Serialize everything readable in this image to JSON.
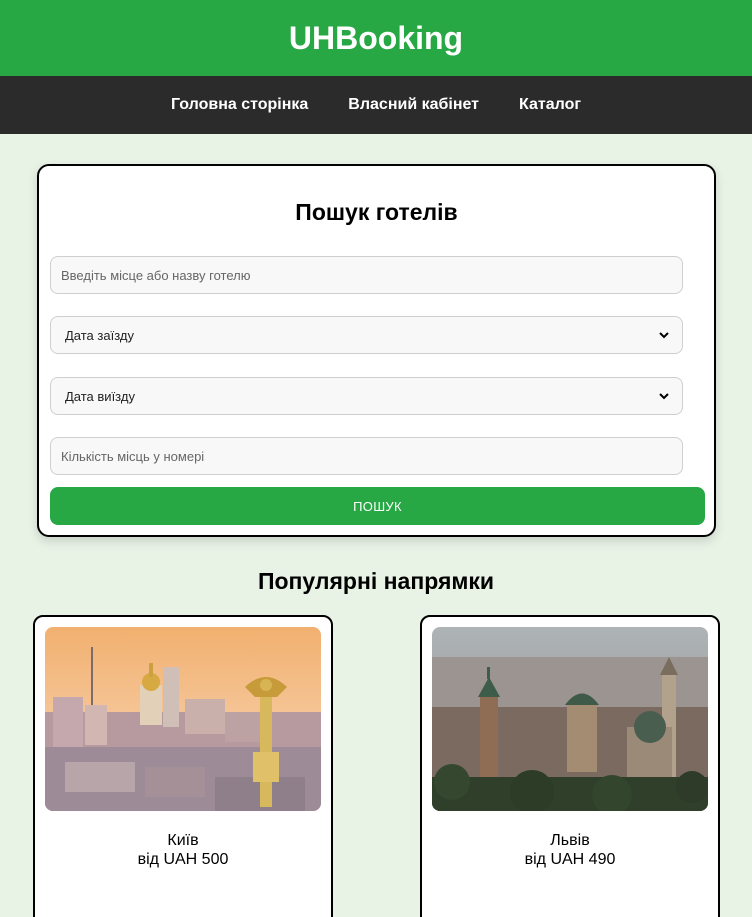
{
  "header": {
    "title": "UHBooking"
  },
  "nav": {
    "items": [
      "Головна сторінка",
      "Власний кабінет",
      "Каталог"
    ]
  },
  "search": {
    "title": "Пошук готелів",
    "place_placeholder": "Введіть місце або назву готелю",
    "checkin_label": "Дата заїзду",
    "checkout_label": "Дата виїзду",
    "guests_placeholder": "Кількість місць у номері",
    "button_label": "ПОШУК"
  },
  "popular": {
    "title": "Популярні напрямки",
    "destinations": [
      {
        "city": "Київ",
        "price": "від UAH 500",
        "image": "kyiv-skyline-image"
      },
      {
        "city": "Львів",
        "price": "від UAH 490",
        "image": "lviv-old-town-image"
      }
    ]
  },
  "colors": {
    "primary": "#28a745",
    "nav_bg": "#2b2b2b",
    "page_bg": "#e8f3e6"
  }
}
